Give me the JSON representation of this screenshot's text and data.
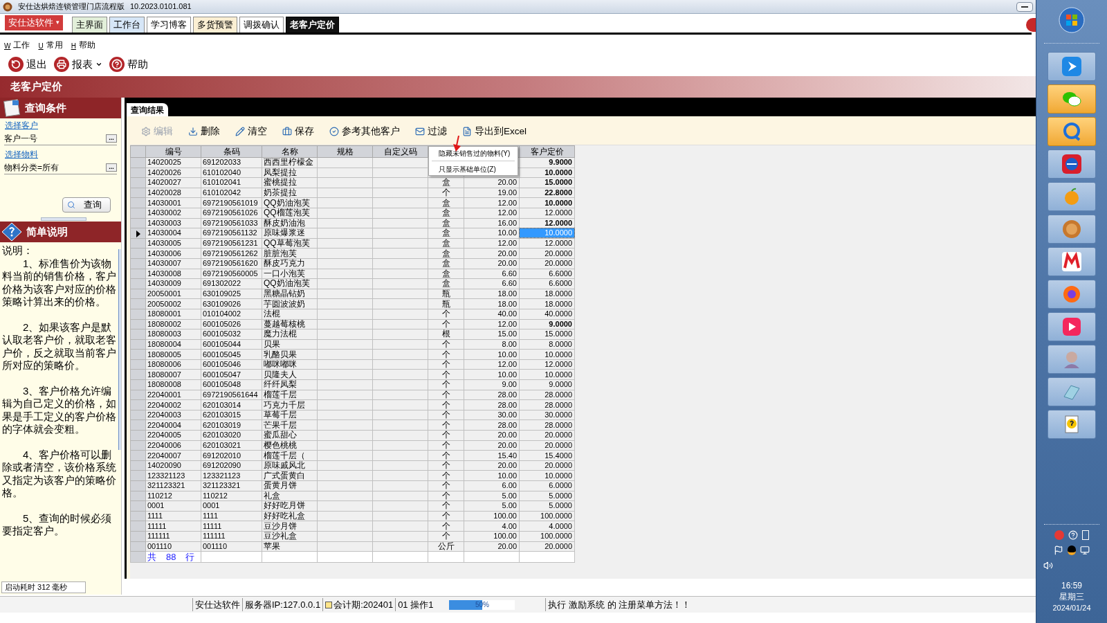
{
  "window": {
    "title": "安仕达烘焙连锁管理门店流程版",
    "version": "10.2023.0101.081"
  },
  "brand_menu": {
    "label": "安仕达软件",
    "caret": "▾"
  },
  "tabs": [
    {
      "label": "主界面",
      "selected": false,
      "color": "#e2efd9"
    },
    {
      "label": "工作台",
      "selected": false,
      "color": "#d6e6f7"
    },
    {
      "label": "学习博客",
      "selected": false,
      "color": "#ffffff"
    },
    {
      "label": "多货预警",
      "selected": false,
      "color": "#fbefd3"
    },
    {
      "label": "调拨确认",
      "selected": false,
      "color": "#ffffff"
    },
    {
      "label": "老客户定价",
      "selected": true,
      "color": "#111111"
    }
  ],
  "menu": [
    {
      "key": "W",
      "label": "工作"
    },
    {
      "key": "U",
      "label": "常用"
    },
    {
      "key": "H",
      "label": "帮助"
    }
  ],
  "toolbar": [
    {
      "kind": "exit",
      "label": "退出",
      "dropdown": false
    },
    {
      "kind": "print",
      "label": "报表",
      "dropdown": true
    },
    {
      "kind": "help",
      "label": "帮助",
      "dropdown": false
    }
  ],
  "page_title": "老客户定价",
  "query_panel": {
    "title": "查询条件",
    "customer_link": "选择客户",
    "customer_value": "客户一号",
    "material_link": "选择物料",
    "material_value": "物料分类=所有",
    "browse": "...",
    "query_button": "查询"
  },
  "help_panel": {
    "title": "简单说明",
    "heading": "说明：",
    "paragraphs": [
      "1、标准售价为该物料当前的销售价格，客户价格为该客户对应的价格策略计算出来的价格。",
      "2、如果该客户是默认取老客户价，就取老客户价，反之就取当前客户所对应的策略价。",
      "3、客户价格允许编辑为自己定义的价格，如果是手工定义的客户价格的字体就会变粗。",
      "4、客户价格可以删除或者清空，该价格系统又指定为该客户的策略价格。",
      "5、查询的时候必须要指定客户。"
    ]
  },
  "startup_time": "启动耗时 312 毫秒",
  "results": {
    "tab": "查询结果",
    "actions": [
      {
        "kind": "edit",
        "label": "编辑",
        "disabled": true
      },
      {
        "kind": "delete",
        "label": "删除",
        "disabled": false
      },
      {
        "kind": "clear",
        "label": "清空",
        "disabled": false
      },
      {
        "kind": "save",
        "label": "保存",
        "disabled": false
      },
      {
        "kind": "reference",
        "label": "参考其他客户",
        "disabled": false
      },
      {
        "kind": "filter",
        "label": "过滤",
        "disabled": false
      },
      {
        "kind": "export",
        "label": "导出到Excel",
        "disabled": false
      }
    ],
    "columns": [
      "编号",
      "条码",
      "名称",
      "规格",
      "自定义码",
      null,
      null,
      "客户定价"
    ],
    "rows": [
      {
        "code": "14020025",
        "barcode": "691202033",
        "name": "西西里柠檬金",
        "price": "9.9000",
        "bold": true,
        "selected": false
      },
      {
        "code": "14020026",
        "barcode": "610102040",
        "name": "凤梨提拉",
        "price": "10.0000",
        "bold": true,
        "selected": false
      },
      {
        "code": "14020027",
        "barcode": "610102041",
        "name": "蜜桃提拉",
        "unit": "盒",
        "standard": "20.00",
        "price": "15.0000",
        "bold": true,
        "selected": false
      },
      {
        "code": "14020028",
        "barcode": "610102042",
        "name": "奶茶提拉",
        "unit": "个",
        "standard": "19.00",
        "price": "22.8000",
        "bold": true,
        "selected": false
      },
      {
        "code": "14030001",
        "barcode": "6972190561019",
        "name": "QQ奶油泡芙",
        "unit": "盒",
        "standard": "12.00",
        "price": "10.0000",
        "bold": true,
        "selected": false
      },
      {
        "code": "14030002",
        "barcode": "6972190561026",
        "name": "QQ榴莲泡芙",
        "unit": "盒",
        "standard": "12.00",
        "price": "12.0000",
        "bold": false,
        "selected": false
      },
      {
        "code": "14030003",
        "barcode": "6972190561033",
        "name": "酥皮奶油泡",
        "unit": "盒",
        "standard": "16.00",
        "price": "12.0000",
        "bold": true,
        "selected": false
      },
      {
        "code": "14030004",
        "barcode": "6972190561132",
        "name": "原味爆浆迷",
        "unit": "盒",
        "standard": "10.00",
        "price": "10.0000",
        "bold": false,
        "selected": true
      },
      {
        "code": "14030005",
        "barcode": "6972190561231",
        "name": "QQ草莓泡芙",
        "unit": "盒",
        "standard": "12.00",
        "price": "12.0000",
        "bold": false,
        "selected": false
      },
      {
        "code": "14030006",
        "barcode": "6972190561262",
        "name": "脏脏泡芙",
        "unit": "盒",
        "standard": "20.00",
        "price": "20.0000",
        "bold": false,
        "selected": false
      },
      {
        "code": "14030007",
        "barcode": "6972190561620",
        "name": "酥皮巧克力",
        "unit": "盒",
        "standard": "20.00",
        "price": "20.0000",
        "bold": false,
        "selected": false
      },
      {
        "code": "14030008",
        "barcode": "6972190560005",
        "name": "一口小泡芙",
        "unit": "盒",
        "standard": "6.60",
        "price": "6.6000",
        "bold": false,
        "selected": false
      },
      {
        "code": "14030009",
        "barcode": "691302022",
        "name": "QQ奶油泡芙",
        "unit": "盒",
        "standard": "6.60",
        "price": "6.6000",
        "bold": false,
        "selected": false
      },
      {
        "code": "20050001",
        "barcode": "630109025",
        "name": "黑糖晶钻奶",
        "unit": "瓶",
        "standard": "18.00",
        "price": "18.0000",
        "bold": false,
        "selected": false
      },
      {
        "code": "20050002",
        "barcode": "630109026",
        "name": "芋圆波波奶",
        "unit": "瓶",
        "standard": "18.00",
        "price": "18.0000",
        "bold": false,
        "selected": false
      },
      {
        "code": "18080001",
        "barcode": "010104002",
        "name": "法棍",
        "unit": "个",
        "standard": "40.00",
        "price": "40.0000",
        "bold": false,
        "selected": false
      },
      {
        "code": "18080002",
        "barcode": "600105026",
        "name": "蔓越莓核桃",
        "unit": "个",
        "standard": "12.00",
        "price": "9.0000",
        "bold": true,
        "selected": false
      },
      {
        "code": "18080003",
        "barcode": "600105032",
        "name": "魔力法棍",
        "unit": "根",
        "standard": "15.00",
        "price": "15.0000",
        "bold": false,
        "selected": false
      },
      {
        "code": "18080004",
        "barcode": "600105044",
        "name": "贝果",
        "unit": "个",
        "standard": "8.00",
        "price": "8.0000",
        "bold": false,
        "selected": false
      },
      {
        "code": "18080005",
        "barcode": "600105045",
        "name": "乳酪贝果",
        "unit": "个",
        "standard": "10.00",
        "price": "10.0000",
        "bold": false,
        "selected": false
      },
      {
        "code": "18080006",
        "barcode": "600105046",
        "name": "嘟咪嘟咪",
        "unit": "个",
        "standard": "12.00",
        "price": "12.0000",
        "bold": false,
        "selected": false
      },
      {
        "code": "18080007",
        "barcode": "600105047",
        "name": "贝隆夫人",
        "unit": "个",
        "standard": "10.00",
        "price": "10.0000",
        "bold": false,
        "selected": false
      },
      {
        "code": "18080008",
        "barcode": "600105048",
        "name": "纤纤凤梨",
        "unit": "个",
        "standard": "9.00",
        "price": "9.0000",
        "bold": false,
        "selected": false
      },
      {
        "code": "22040001",
        "barcode": "6972190561644",
        "name": "榴莲千层",
        "unit": "个",
        "standard": "28.00",
        "price": "28.0000",
        "bold": false,
        "selected": false
      },
      {
        "code": "22040002",
        "barcode": "620103014",
        "name": "巧克力千层",
        "unit": "个",
        "standard": "28.00",
        "price": "28.0000",
        "bold": false,
        "selected": false
      },
      {
        "code": "22040003",
        "barcode": "620103015",
        "name": "草莓千层",
        "unit": "个",
        "standard": "30.00",
        "price": "30.0000",
        "bold": false,
        "selected": false
      },
      {
        "code": "22040004",
        "barcode": "620103019",
        "name": "芒果千层",
        "unit": "个",
        "standard": "28.00",
        "price": "28.0000",
        "bold": false,
        "selected": false
      },
      {
        "code": "22040005",
        "barcode": "620103020",
        "name": "蜜瓜甜心",
        "unit": "个",
        "standard": "20.00",
        "price": "20.0000",
        "bold": false,
        "selected": false
      },
      {
        "code": "22040006",
        "barcode": "620103021",
        "name": "樱色桃桃",
        "unit": "个",
        "standard": "20.00",
        "price": "20.0000",
        "bold": false,
        "selected": false
      },
      {
        "code": "22040007",
        "barcode": "691202010",
        "name": "榴莲千层（",
        "unit": "个",
        "standard": "15.40",
        "price": "15.4000",
        "bold": false,
        "selected": false
      },
      {
        "code": "14020090",
        "barcode": "691202090",
        "name": "原味戚风北",
        "unit": "个",
        "standard": "20.00",
        "price": "20.0000",
        "bold": false,
        "selected": false
      },
      {
        "code": "123321123",
        "barcode": "123321123",
        "name": "广式蛋黄白",
        "unit": "个",
        "standard": "10.00",
        "price": "10.0000",
        "bold": false,
        "selected": false
      },
      {
        "code": "321123321",
        "barcode": "321123321",
        "name": "蛋黄月饼",
        "unit": "个",
        "standard": "6.00",
        "price": "6.0000",
        "bold": false,
        "selected": false
      },
      {
        "code": "110212",
        "barcode": "110212",
        "name": "礼盒",
        "unit": "个",
        "standard": "5.00",
        "price": "5.0000",
        "bold": false,
        "selected": false
      },
      {
        "code": "0001",
        "barcode": "0001",
        "name": "好好吃月饼",
        "unit": "个",
        "standard": "5.00",
        "price": "5.0000",
        "bold": false,
        "selected": false
      },
      {
        "code": "1111",
        "barcode": "1111",
        "name": "好好吃礼盒",
        "unit": "个",
        "standard": "100.00",
        "price": "100.0000",
        "bold": false,
        "selected": false
      },
      {
        "code": "11111",
        "barcode": "11111",
        "name": "豆沙月饼",
        "unit": "个",
        "standard": "4.00",
        "price": "4.0000",
        "bold": false,
        "selected": false
      },
      {
        "code": "111111",
        "barcode": "111111",
        "name": "豆沙礼盒",
        "unit": "个",
        "standard": "100.00",
        "price": "100.0000",
        "bold": false,
        "selected": false
      },
      {
        "code": "001110",
        "barcode": "001110",
        "name": "苹果",
        "unit": "公斤",
        "standard": "20.00",
        "price": "20.0000",
        "bold": false,
        "selected": false
      }
    ],
    "footer": [
      "共",
      "88",
      "行"
    ],
    "context_menu": [
      "隐藏未销售过的物料(Y)",
      "只显示基础单位(Z)"
    ]
  },
  "status_bar": [
    {
      "kind": "text",
      "text": "安仕达软件"
    },
    {
      "kind": "text",
      "text": "服务器IP:127.0.0.1"
    },
    {
      "kind": "calendar",
      "text": "会计期:202401"
    },
    {
      "kind": "text",
      "text": "01 操作1"
    },
    {
      "kind": "progress",
      "text": "50%",
      "level": 0.5
    },
    {
      "kind": "message",
      "text": "执行 激励系统 的 注册菜单方法！！"
    }
  ],
  "taskbar": {
    "buttons": [
      {
        "active": false
      },
      {
        "active": true
      },
      {
        "active": true
      },
      {
        "active": false
      },
      {
        "active": false
      },
      {
        "active": false
      },
      {
        "active": false
      },
      {
        "active": false
      },
      {
        "active": false
      },
      {
        "active": false
      },
      {
        "active": false
      },
      {
        "active": false
      }
    ],
    "time": "16:59",
    "weekday": "星期三",
    "date": "2024/01/24"
  }
}
